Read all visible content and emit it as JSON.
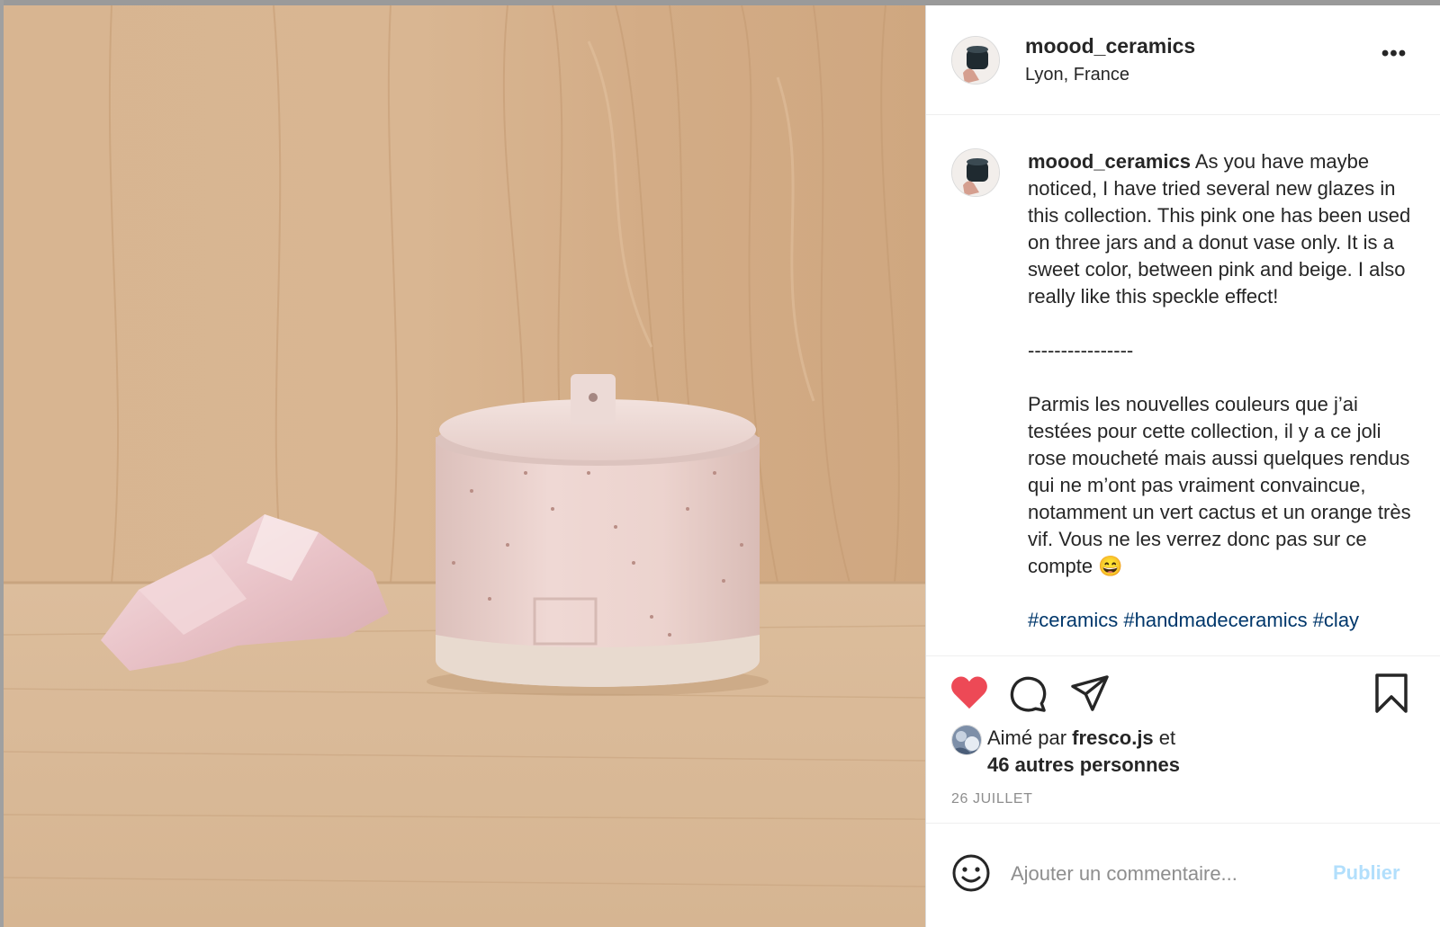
{
  "post": {
    "username": "moood_ceramics",
    "location": "Lyon, France",
    "more_label": "•••"
  },
  "caption": {
    "username": "moood_ceramics",
    "paragraph1": "As you have maybe noticed, I have tried several new glazes in this collection. This pink one has been used on three jars and a donut vase only. It is a sweet color, between pink and beige. I also really like this speckle effect!",
    "separator": "----------------",
    "paragraph2": "Parmis les nouvelles couleurs que j’ai testées pour cette collection, il y a ce joli rose moucheté mais aussi quelques rendus qui ne m’ont pas vraiment convaincue, notamment un vert cactus et un orange très vif. Vous ne les verrez donc pas sur ce compte 😄",
    "hashtags": "#ceramics #handmadeceramics #clay"
  },
  "likes": {
    "prefix": "Aimé par",
    "user": "fresco.js",
    "conjunction": "et",
    "others": "46 autres personnes"
  },
  "date": "26 JUILLET",
  "comment_box": {
    "placeholder": "Ajouter un commentaire...",
    "publish_label": "Publier"
  },
  "colors": {
    "like_red": "#ed4956",
    "link_blue": "#00376b",
    "publish_disabled": "#b2dffc"
  },
  "icons": {
    "like": "heart-icon",
    "comment": "comment-icon",
    "share": "share-icon",
    "save": "bookmark-icon",
    "emoji": "emoji-icon",
    "more": "more-options-icon"
  }
}
